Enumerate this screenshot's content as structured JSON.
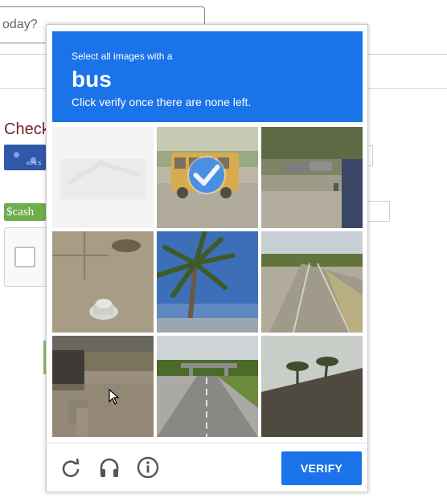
{
  "background": {
    "search_placeholder": "oday?",
    "section_title": "Check",
    "card1_brand": "KOHL'S",
    "card2_text": "$cash"
  },
  "challenge": {
    "instruction_top": "Select all images with a",
    "target_word": "bus",
    "instruction_bottom": "Click verify once there are none left.",
    "tiles": [
      {
        "content": "faded white blank",
        "selected": false
      },
      {
        "content": "yellow school bus on road",
        "selected": true
      },
      {
        "content": "parked cars and sign",
        "selected": false
      },
      {
        "content": "sidewalk with fire hydrant",
        "selected": false
      },
      {
        "content": "palm tree and sky",
        "selected": false
      },
      {
        "content": "rural road",
        "selected": false
      },
      {
        "content": "building and sidewalk",
        "selected": false
      },
      {
        "content": "highway with overpass",
        "selected": false
      },
      {
        "content": "palm trees on hill",
        "selected": false
      }
    ],
    "footer": {
      "reload_icon": "reload-icon",
      "audio_icon": "headphones-icon",
      "info_icon": "info-icon",
      "verify_label": "VERIFY"
    },
    "colors": {
      "accent": "#1a73e8",
      "check": "#4a90e2"
    }
  }
}
